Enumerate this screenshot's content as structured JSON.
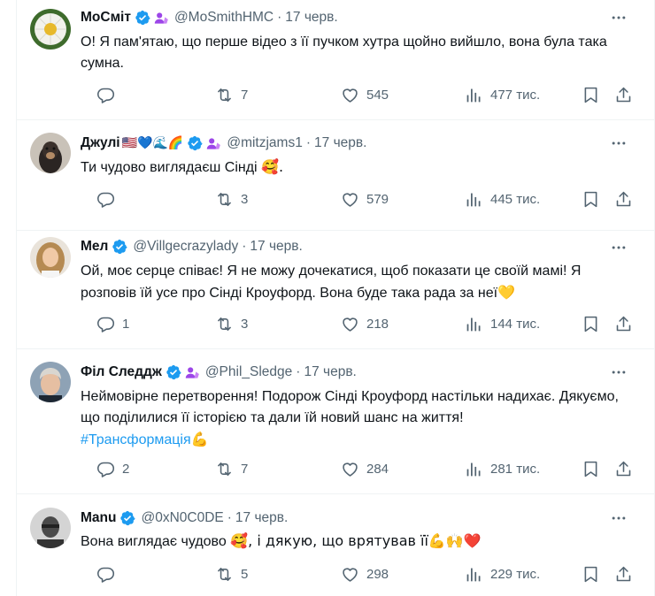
{
  "tweets": [
    {
      "name": "МоСміт",
      "name_emoji": "",
      "handle": "@MoSmithHMC",
      "date": "17 черв.",
      "text": "О! Я пам'ятаю, що перше відео з її пучком хутра щойно вийшло, вона була така сумна.",
      "text_emoji": "",
      "hashtag": "",
      "hashtag_emoji": "",
      "replies": "",
      "retweets": "7",
      "likes": "545",
      "views": "477 тис."
    },
    {
      "name": "Джулі",
      "name_emoji": "🇺🇸💙🌊🌈",
      "handle": "@mitzjams1",
      "date": "17 черв.",
      "text": "Ти чудово виглядаєш Сінді",
      "text_emoji": "🥰.",
      "hashtag": "",
      "hashtag_emoji": "",
      "replies": "",
      "retweets": "3",
      "likes": "579",
      "views": "445 тис."
    },
    {
      "name": "Мел",
      "name_emoji": "",
      "handle": "@Villgecrazylady",
      "date": "17 черв.",
      "text": "Ой, моє серце співає! Я не можу дочекатися, щоб показати це своїй мамі! Я розповів їй усе про Сінді Кроуфорд. Вона буде така рада за неї",
      "text_emoji": "💛",
      "hashtag": "",
      "hashtag_emoji": "",
      "replies": "1",
      "retweets": "3",
      "likes": "218",
      "views": "144 тис."
    },
    {
      "name": "Філ Следдж",
      "name_emoji": "",
      "handle": "@Phil_Sledge",
      "date": "17 черв.",
      "text": "Неймовірне перетворення! Подорож Сінді Кроуфорд настільки надихає. Дякуємо, що поділилися її історією та дали їй новий шанс на життя!",
      "text_emoji": "",
      "hashtag": "#Трансформація",
      "hashtag_emoji": "💪",
      "replies": "2",
      "retweets": "7",
      "likes": "284",
      "views": "281 тис."
    },
    {
      "name": "Manu",
      "name_emoji": "",
      "handle": "@0xN0C0DE",
      "date": "17 черв.",
      "text": "Вона виглядає чудово",
      "text_emoji": "🥰, і дякую, що врятував її💪🙌❤️",
      "hashtag": "",
      "hashtag_emoji": "",
      "replies": "",
      "retweets": "5",
      "likes": "298",
      "views": "229 тис."
    }
  ],
  "colors": {
    "verified": "#1d9bf0",
    "subscriber": "#9c46e8",
    "text": "#0f1419",
    "secondary": "#536471",
    "link": "#1d9bf0",
    "divider": "#eff3f4"
  },
  "icons": [
    "more-icon",
    "reply-icon",
    "retweet-icon",
    "like-icon",
    "views-icon",
    "bookmark-icon",
    "share-icon",
    "verified-icon",
    "subscriber-icon"
  ]
}
